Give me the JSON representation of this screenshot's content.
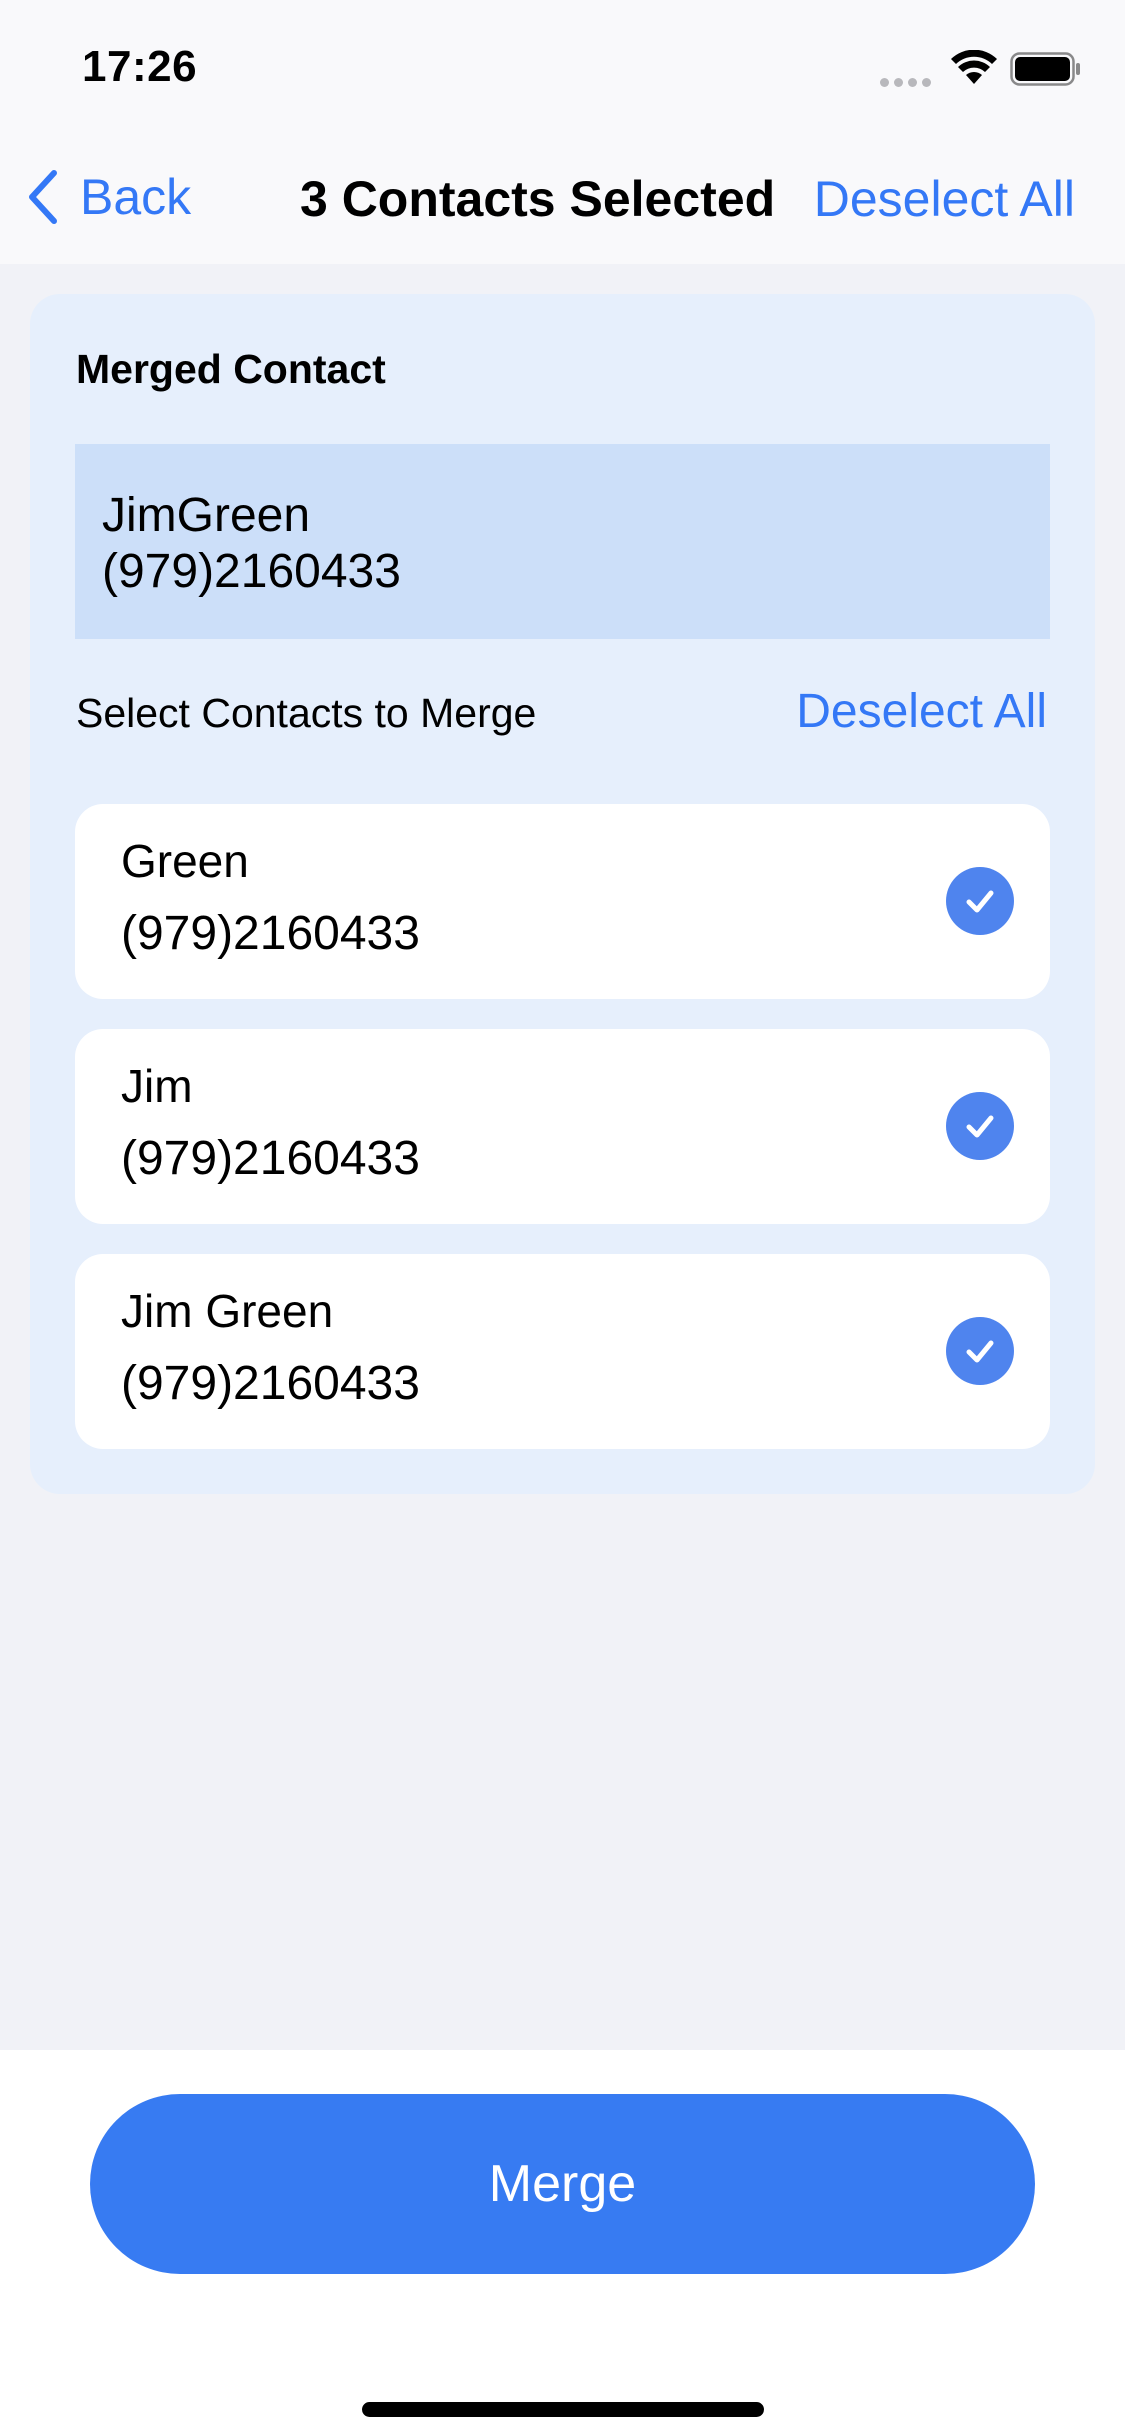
{
  "status_bar": {
    "time": "17:26",
    "icons": [
      "cellular-signal-icon",
      "wifi-icon",
      "battery-icon"
    ]
  },
  "nav": {
    "back_label": "Back",
    "title": "3 Contacts Selected",
    "deselect_all": "Deselect All"
  },
  "card": {
    "title": "Merged Contact",
    "merged": {
      "name": "JimGreen",
      "phone": "(979)2160433"
    },
    "select_label": "Select Contacts to Merge",
    "deselect_all": "Deselect All",
    "contacts": [
      {
        "name": "Green",
        "phone": "(979)2160433",
        "selected": true
      },
      {
        "name": "Jim",
        "phone": "(979)2160433",
        "selected": true
      },
      {
        "name": "Jim Green",
        "phone": "(979)2160433",
        "selected": true
      }
    ]
  },
  "actions": {
    "merge_label": "Merge"
  },
  "colors": {
    "accent": "#3478F6",
    "button": "#377BF2",
    "card_bg": "#E6EFFC",
    "merged_bg": "#CCDFF9",
    "check": "#4F84EE",
    "page_bg": "#F1F2F7"
  }
}
